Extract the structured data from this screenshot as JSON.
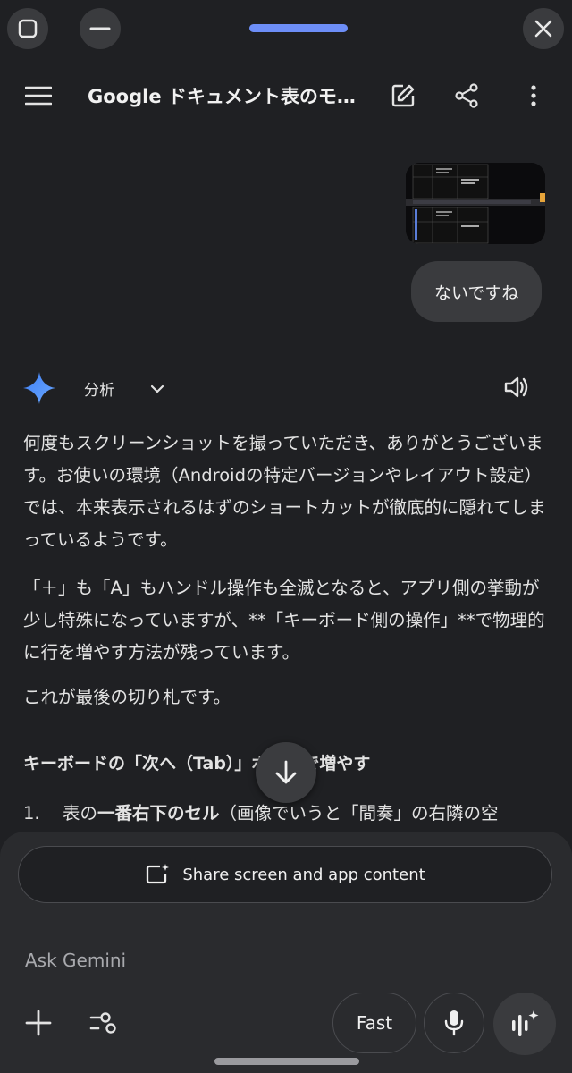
{
  "header": {
    "title": "Google ドキュメント表のモ…"
  },
  "chat": {
    "user_message": "ないですね",
    "mode_label": "分析",
    "response": {
      "p1": "何度もスクリーンショットを撮っていただき、ありがとうございます。お使いの環境（Androidの特定バージョンやレイアウト設定）では、本来表示されるはずのショートカットが徹底的に隠れてしまっているようです。",
      "p2": "「＋」も「A」もハンドル操作も全滅となると、アプリ側の挙動が少し特殊になっていますが、**「キーボード側の操作」**で物理的に行を増やす方法が残っています。",
      "p3": "これが最後の切り札です。",
      "heading": "キーボードの「次へ（Tab）」ボタンで増やす",
      "step1_num": "1.",
      "step1_a": "表の",
      "step1_bold": "一番右下のセル",
      "step1_b": "（画像でいうと「間奏」の右隣の空"
    }
  },
  "composer": {
    "share_label": "Share screen and app content",
    "placeholder": "Ask Gemini",
    "fast_label": "Fast"
  },
  "colors": {
    "background": "#1f2023",
    "sheet": "#2a2b2e",
    "accent_pill": "#6d8ef7",
    "gemini_star": "#4c8df6"
  }
}
